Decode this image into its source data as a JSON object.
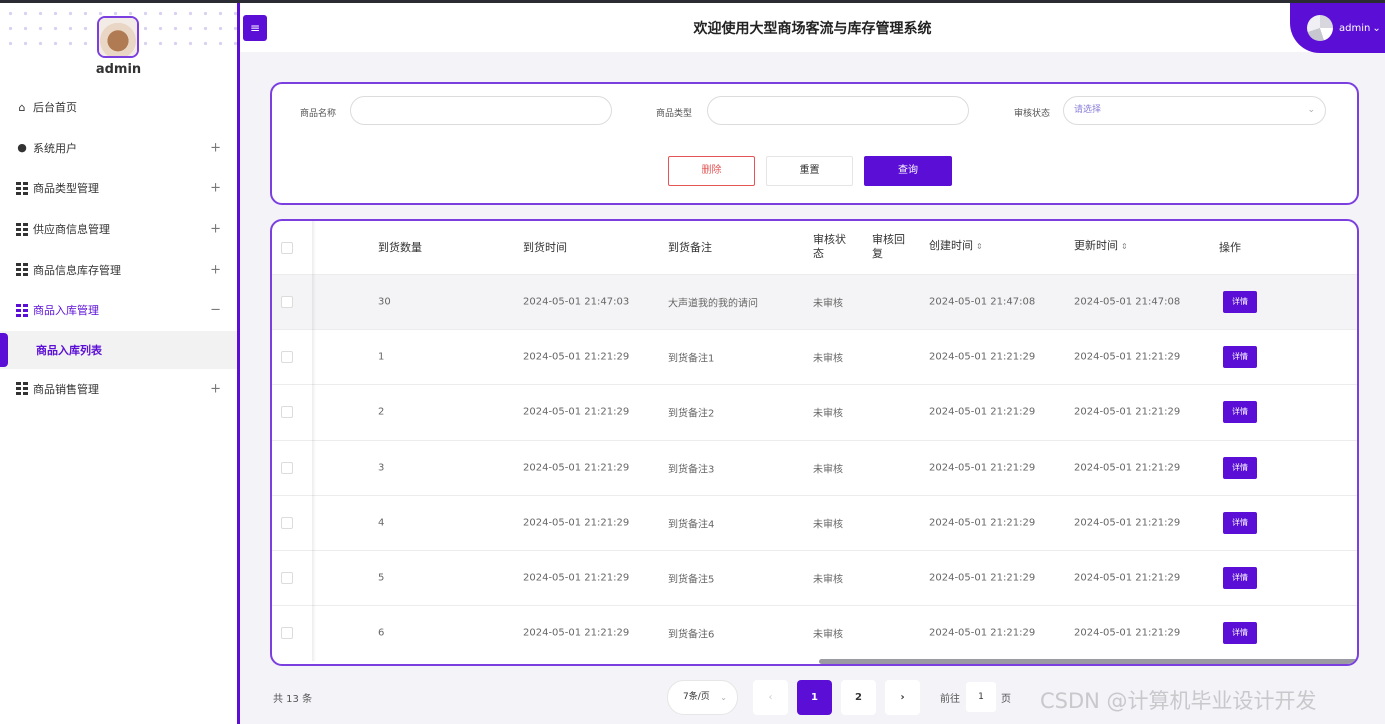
{
  "header": {
    "title": "欢迎使用大型商场客流与库存管理系统",
    "user": "admin"
  },
  "sidebar": {
    "user": "admin",
    "items": [
      {
        "label": "后台首页",
        "icon": "home-icon"
      },
      {
        "label": "系统用户",
        "icon": "user-icon",
        "toggle": "+"
      },
      {
        "label": "商品类型管理",
        "icon": "grid-icon",
        "toggle": "+"
      },
      {
        "label": "供应商信息管理",
        "icon": "grid-icon",
        "toggle": "+"
      },
      {
        "label": "商品信息库存管理",
        "icon": "grid-icon",
        "toggle": "+"
      },
      {
        "label": "商品入库管理",
        "icon": "grid-icon",
        "toggle": "−"
      },
      {
        "label": "商品销售管理",
        "icon": "grid-icon",
        "toggle": "+"
      }
    ],
    "sub_item": "商品入库列表"
  },
  "search": {
    "name_label": "商品名称",
    "type_label": "商品类型",
    "status_label": "审核状态",
    "status_placeholder": "请选择",
    "delete": "删除",
    "reset": "重置",
    "query": "查询"
  },
  "table": {
    "headers": {
      "qty": "到货数量",
      "time": "到货时间",
      "remark": "到货备注",
      "status": "审核状",
      "status2": "态",
      "reply": "审核回",
      "reply2": "复",
      "created": "创建时间",
      "updated": "更新时间",
      "ops": "操作"
    },
    "detail_label": "详情",
    "rows": [
      {
        "qty": "30",
        "time": "2024-05-01 21:47:03",
        "remark": "大声道我的我的请问",
        "status": "未审核",
        "reply": "",
        "created": "2024-05-01 21:47:08",
        "updated": "2024-05-01 21:47:08"
      },
      {
        "qty": "1",
        "time": "2024-05-01 21:21:29",
        "remark": "到货备注1",
        "status": "未审核",
        "reply": "",
        "created": "2024-05-01 21:21:29",
        "updated": "2024-05-01 21:21:29"
      },
      {
        "qty": "2",
        "time": "2024-05-01 21:21:29",
        "remark": "到货备注2",
        "status": "未审核",
        "reply": "",
        "created": "2024-05-01 21:21:29",
        "updated": "2024-05-01 21:21:29"
      },
      {
        "qty": "3",
        "time": "2024-05-01 21:21:29",
        "remark": "到货备注3",
        "status": "未审核",
        "reply": "",
        "created": "2024-05-01 21:21:29",
        "updated": "2024-05-01 21:21:29"
      },
      {
        "qty": "4",
        "time": "2024-05-01 21:21:29",
        "remark": "到货备注4",
        "status": "未审核",
        "reply": "",
        "created": "2024-05-01 21:21:29",
        "updated": "2024-05-01 21:21:29"
      },
      {
        "qty": "5",
        "time": "2024-05-01 21:21:29",
        "remark": "到货备注5",
        "status": "未审核",
        "reply": "",
        "created": "2024-05-01 21:21:29",
        "updated": "2024-05-01 21:21:29"
      },
      {
        "qty": "6",
        "time": "2024-05-01 21:21:29",
        "remark": "到货备注6",
        "status": "未审核",
        "reply": "",
        "created": "2024-05-01 21:21:29",
        "updated": "2024-05-01 21:21:29"
      }
    ]
  },
  "pagination": {
    "total": "共 13 条",
    "page_size": "7条/页",
    "prev": "‹",
    "pages": [
      "1",
      "2"
    ],
    "next": "›",
    "goto_prefix": "前往",
    "goto_value": "1",
    "goto_suffix": "页"
  },
  "watermark": "CSDN @计算机毕业设计开发",
  "colors": {
    "accent": "#5b0fd6",
    "danger": "#e45656"
  }
}
